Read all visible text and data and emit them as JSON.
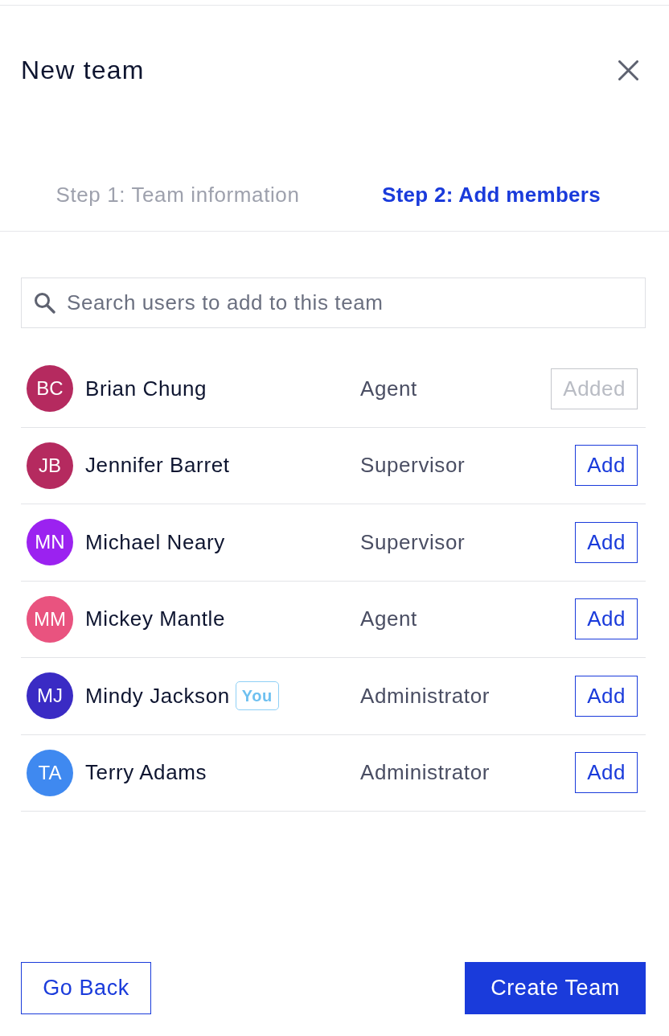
{
  "dialog": {
    "title": "New team"
  },
  "steps": [
    {
      "label": "Step 1: Team information",
      "selected": false
    },
    {
      "label": "Step 2: Add members",
      "selected": true
    }
  ],
  "search": {
    "placeholder": "Search users to add to this team"
  },
  "users": [
    {
      "initials": "BC",
      "name": "Brian Chung",
      "role": "Agent",
      "color": "#b52a5f",
      "added": true,
      "action": "Added"
    },
    {
      "initials": "JB",
      "name": "Jennifer Barret",
      "role": "Supervisor",
      "color": "#b52a5f",
      "added": false,
      "action": "Add"
    },
    {
      "initials": "MN",
      "name": "Michael Neary",
      "role": "Supervisor",
      "color": "#9b22f0",
      "added": false,
      "action": "Add"
    },
    {
      "initials": "MM",
      "name": "Mickey Mantle",
      "role": "Agent",
      "color": "#e9537f",
      "added": false,
      "action": "Add"
    },
    {
      "initials": "MJ",
      "name": "Mindy Jackson",
      "badge": "You",
      "role": "Administrator",
      "color": "#3a2bc4",
      "added": false,
      "action": "Add"
    },
    {
      "initials": "TA",
      "name": "Terry Adams",
      "role": "Administrator",
      "color": "#3f89f0",
      "added": false,
      "action": "Add"
    }
  ],
  "footer": {
    "back": "Go Back",
    "create": "Create Team"
  }
}
